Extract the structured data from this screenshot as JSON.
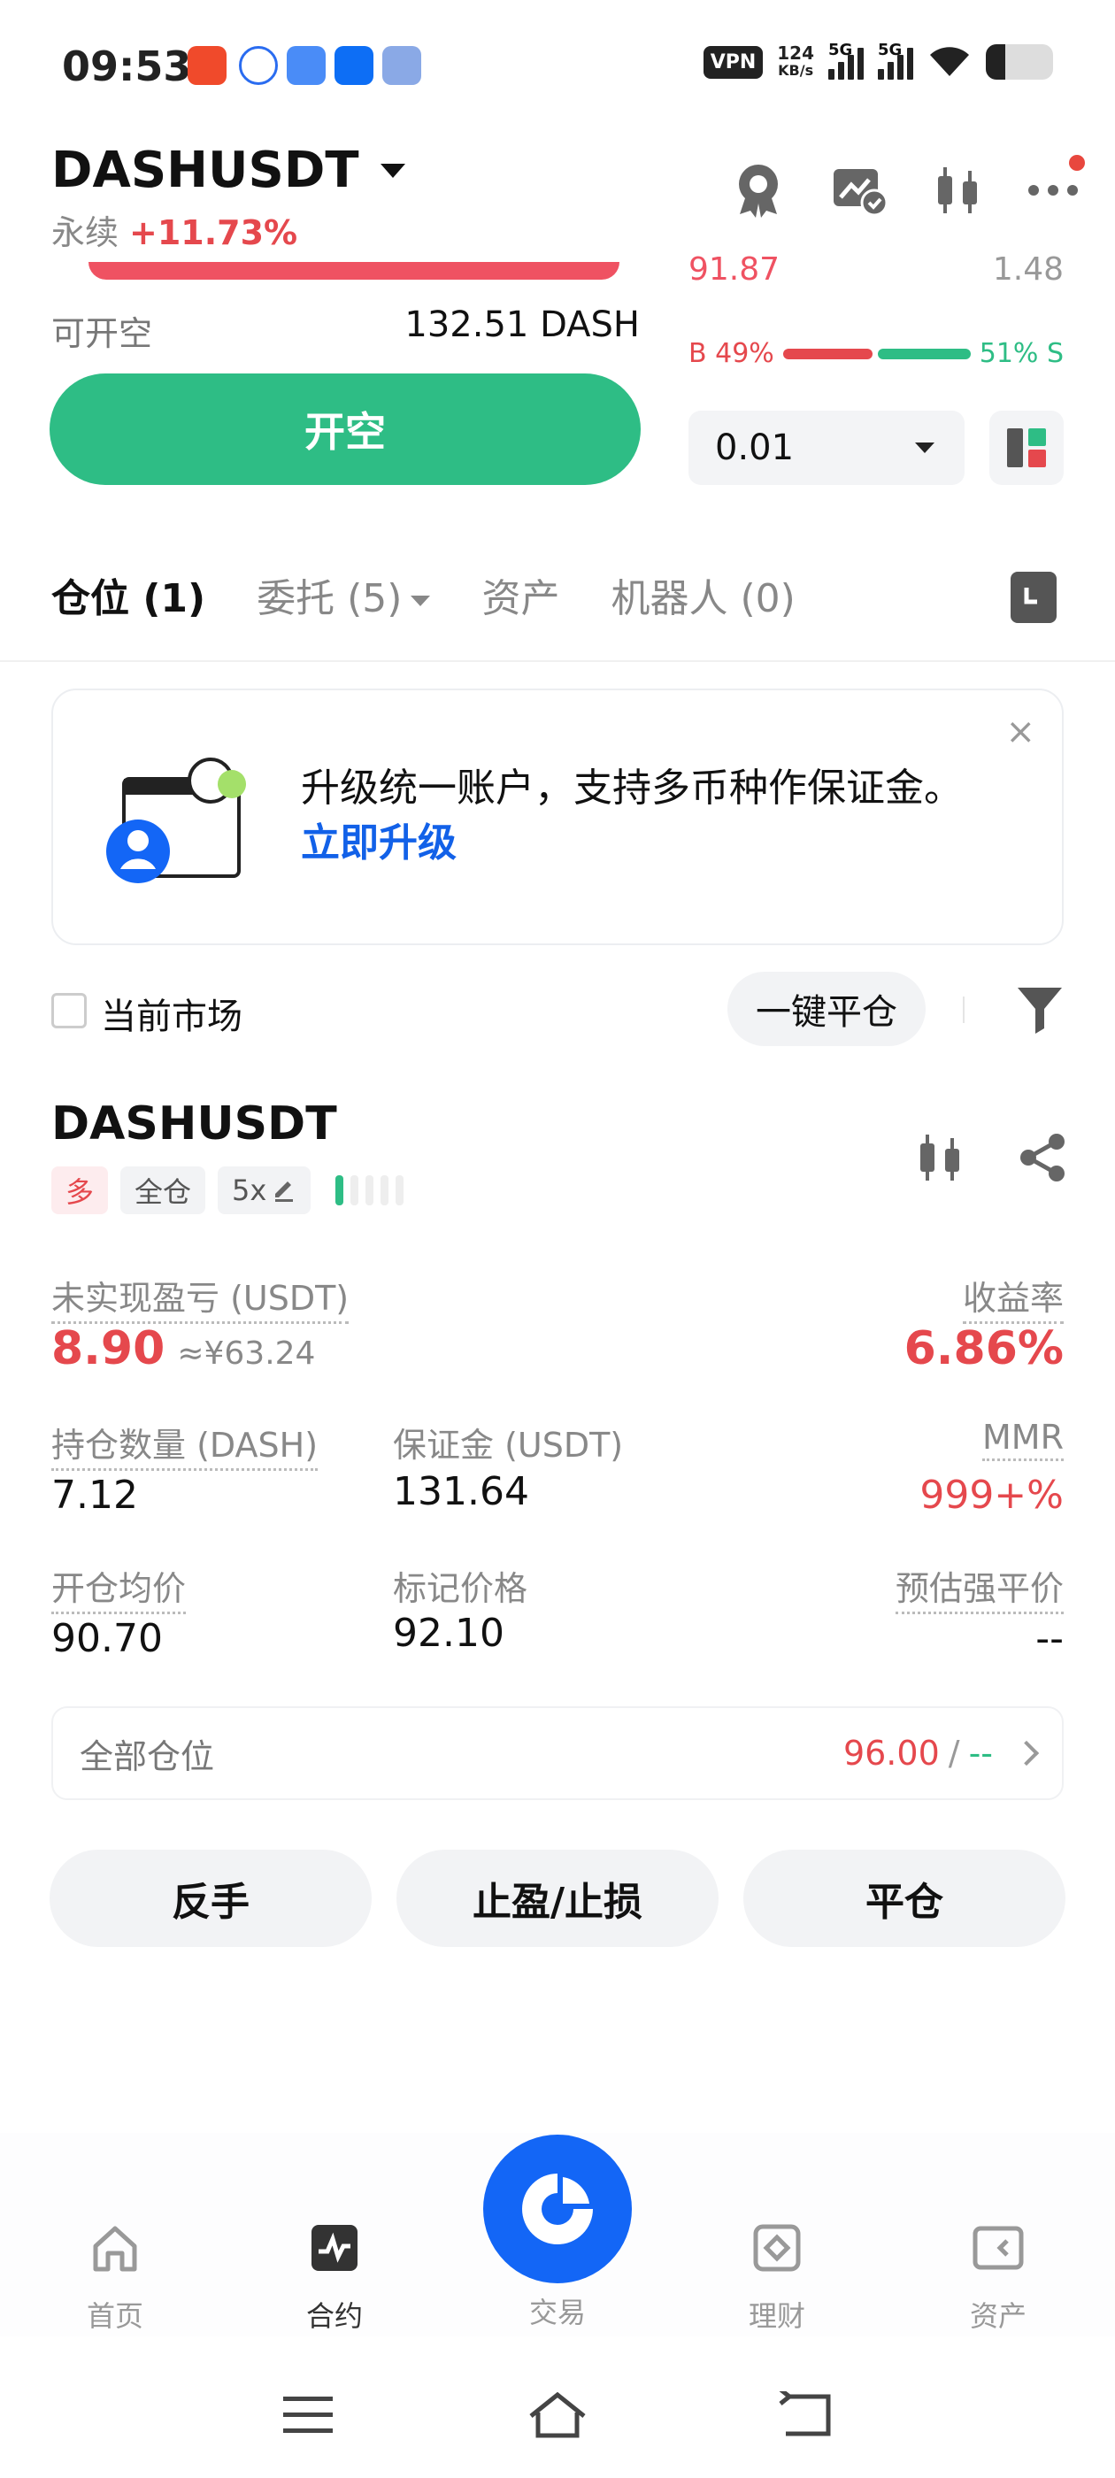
{
  "status_bar": {
    "time": "09:53",
    "vpn": "VPN",
    "speed_value": "124",
    "speed_unit": "KB/s",
    "net1": "5G",
    "net2": "5G"
  },
  "header": {
    "symbol": "DASHUSDT",
    "type": "永续",
    "change": "+11.73%",
    "icons": [
      "badge-icon",
      "chart-check-icon",
      "candlestick-icon",
      "more-icon"
    ]
  },
  "order_panel": {
    "open_label": "可开空",
    "open_value": "132.51 DASH",
    "open_button": "开空",
    "book_price": "91.87",
    "book_size": "1.48",
    "buy_ratio": "B 49%",
    "sell_ratio": "51% S",
    "buy_fraction": 0.49,
    "precision": "0.01"
  },
  "tabs": {
    "positions": "仓位 (1)",
    "orders": "委托 (5)",
    "assets": "资产",
    "bots": "机器人 (0)"
  },
  "banner": {
    "text": "升级统一账户，支持多币种作保证金。",
    "link": "立即升级",
    "close": "×"
  },
  "filter": {
    "current_market": "当前市场",
    "close_all": "一键平仓"
  },
  "position": {
    "symbol": "DASHUSDT",
    "side": "多",
    "margin_mode": "全仓",
    "leverage": "5x",
    "risk_level": 1,
    "unrealized_pnl_label": "未实现盈亏 (USDT)",
    "unrealized_pnl": "8.90",
    "unrealized_pnl_cny": "≈¥63.24",
    "roe_label": "收益率",
    "roe": "6.86%",
    "size_label": "持仓数量 (DASH)",
    "size": "7.12",
    "margin_label": "保证金 (USDT)",
    "margin": "131.64",
    "mmr_label": "MMR",
    "mmr": "999+%",
    "entry_label": "开仓均价",
    "entry": "90.70",
    "mark_label": "标记价格",
    "mark": "92.10",
    "liq_label": "预估强平价",
    "liq": "--",
    "all_label": "全部仓位",
    "all_value_red": "96.00",
    "all_sep": "/",
    "all_value_green": "--"
  },
  "actions": {
    "reverse": "反手",
    "tpsl": "止盈/止损",
    "close": "平仓"
  },
  "nav": {
    "home": "首页",
    "futures": "合约",
    "trade": "交易",
    "earn": "理财",
    "assets": "资产"
  },
  "colors": {
    "green": "#2ebd85",
    "red": "#e5484d",
    "blue": "#1366f6"
  }
}
